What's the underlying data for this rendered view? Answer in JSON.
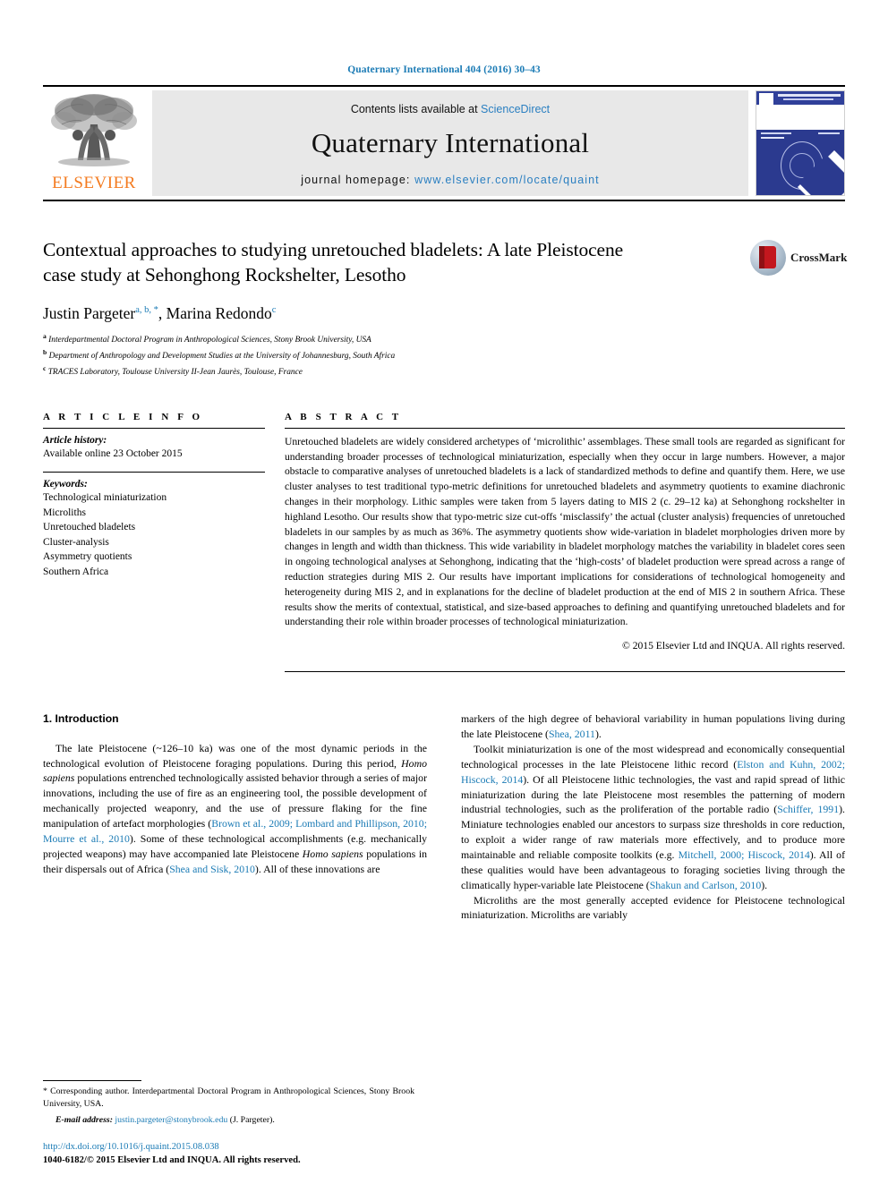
{
  "running_head": "Quaternary International 404 (2016) 30–43",
  "masthead": {
    "contents_prefix": "Contents lists available at ",
    "sciencedirect": "ScienceDirect",
    "journal_title": "Quaternary International",
    "homepage_label": "journal homepage: ",
    "homepage_url": "www.elsevier.com/locate/quaint",
    "publisher_wordmark": "ELSEVIER",
    "publisher_color": "#f47b20",
    "link_color": "#2a7fc1"
  },
  "article": {
    "title": "Contextual approaches to studying unretouched bladelets: A late Pleistocene case study at Sehonghong Rockshelter, Lesotho",
    "crossmark_label": "CrossMark",
    "authors": [
      {
        "name": "Justin Pargeter",
        "marks": "a, b, *"
      },
      {
        "name": "Marina Redondo",
        "marks": "c"
      }
    ],
    "authors_line": "Justin Pargeter",
    "author2_line": ", Marina Redondo",
    "affiliations": [
      {
        "mark": "a",
        "text": "Interdepartmental Doctoral Program in Anthropological Sciences, Stony Brook University, USA"
      },
      {
        "mark": "b",
        "text": "Department of Anthropology and Development Studies at the University of Johannesburg, South Africa"
      },
      {
        "mark": "c",
        "text": "TRACES Laboratory, Toulouse University II-Jean Jaurès, Toulouse, France"
      }
    ]
  },
  "article_info": {
    "heading": "A R T I C L E  I N F O",
    "history_label": "Article history:",
    "history_value": "Available online 23 October 2015",
    "keywords_label": "Keywords:",
    "keywords": [
      "Technological miniaturization",
      "Microliths",
      "Unretouched bladelets",
      "Cluster-analysis",
      "Asymmetry quotients",
      "Southern Africa"
    ]
  },
  "abstract": {
    "heading": "A B S T R A C T",
    "text": "Unretouched bladelets are widely considered archetypes of ‘microlithic’ assemblages. These small tools are regarded as significant for understanding broader processes of technological miniaturization, especially when they occur in large numbers. However, a major obstacle to comparative analyses of unretouched bladelets is a lack of standardized methods to define and quantify them. Here, we use cluster analyses to test traditional typo-metric definitions for unretouched bladelets and asymmetry quotients to examine diachronic changes in their morphology. Lithic samples were taken from 5 layers dating to MIS 2 (c. 29–12 ka) at Sehonghong rockshelter in highland Lesotho. Our results show that typo-metric size cut-offs ‘misclassify’ the actual (cluster analysis) frequencies of unretouched bladelets in our samples by as much as 36%. The asymmetry quotients show wide-variation in bladelet morphologies driven more by changes in length and width than thickness. This wide variability in bladelet morphology matches the variability in bladelet cores seen in ongoing technological analyses at Sehonghong, indicating that the ‘high-costs’ of bladelet production were spread across a range of reduction strategies during MIS 2. Our results have important implications for considerations of technological homogeneity and heterogeneity during MIS 2, and in explanations for the decline of bladelet production at the end of MIS 2 in southern Africa. These results show the merits of contextual, statistical, and size-based approaches to defining and quantifying unretouched bladelets and for understanding their role within broader processes of technological miniaturization.",
    "copyright": "© 2015 Elsevier Ltd and INQUA. All rights reserved."
  },
  "body": {
    "section_number_title": "1. Introduction",
    "left_para_1": {
      "a": "The late Pleistocene (~126–10 ka) was one of the most dynamic periods in the technological evolution of Pleistocene foraging populations. During this period, ",
      "it1": "Homo sapiens",
      "b": " populations entrenched technologically assisted behavior through a series of major innovations, including the use of fire as an engineering tool, the possible development of mechanically projected weaponry, and the use of pressure flaking for the fine manipulation of artefact morphologies (",
      "ref1": "Brown et al., 2009; Lombard and Phillipson, 2010; Mourre et al., 2010",
      "c": "). Some of these technological accomplishments (e.g. mechanically projected weapons) may have accompanied late Pleistocene ",
      "it2": "Homo sapiens",
      "d": " populations in their dispersals out of Africa (",
      "ref2": "Shea and Sisk, 2010",
      "e": "). All of these innovations are"
    },
    "right_para_1": {
      "a": "markers of the high degree of behavioral variability in human populations living during the late Pleistocene (",
      "ref1": "Shea, 2011",
      "b": ")."
    },
    "right_para_2": {
      "a": "Toolkit miniaturization is one of the most widespread and economically consequential technological processes in the late Pleistocene lithic record (",
      "ref1": "Elston and Kuhn, 2002; Hiscock, 2014",
      "b": "). Of all Pleistocene lithic technologies, the vast and rapid spread of lithic miniaturization during the late Pleistocene most resembles the patterning of modern industrial technologies, such as the proliferation of the portable radio (",
      "ref2": "Schiffer, 1991",
      "c": "). Miniature technologies enabled our ancestors to surpass size thresholds in core reduction, to exploit a wider range of raw materials more effectively, and to produce more maintainable and reliable composite toolkits (e.g. ",
      "ref3": "Mitchell, 2000; Hiscock, 2014",
      "d": "). All of these qualities would have been advantageous to foraging societies living through the climatically hyper-variable late Pleistocene (",
      "ref4": "Shakun and Carlson, 2010",
      "e": ")."
    },
    "right_para_3": {
      "a": "Microliths are the most generally accepted evidence for Pleistocene technological miniaturization. Microliths are variably"
    }
  },
  "footnotes": {
    "corresponding": "* Corresponding author. Interdepartmental Doctoral Program in Anthropological Sciences, Stony Brook University, USA.",
    "email_label": "E-mail address:",
    "email": "justin.pargeter@stonybrook.edu",
    "email_attrib": "(J. Pargeter).",
    "doi": "http://dx.doi.org/10.1016/j.quaint.2015.08.038",
    "issn_line": "1040-6182/© 2015 Elsevier Ltd and INQUA. All rights reserved."
  }
}
